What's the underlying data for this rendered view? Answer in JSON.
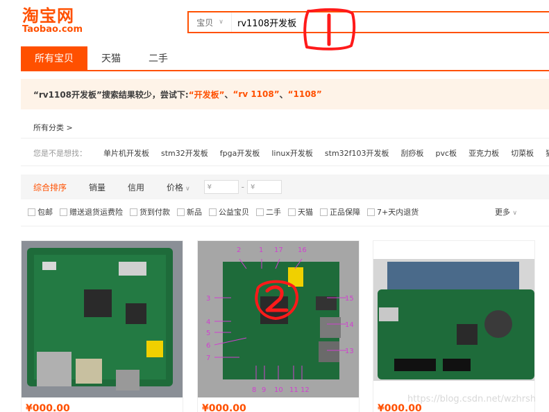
{
  "logo": {
    "cn": "淘宝网",
    "en": "Taobao.com"
  },
  "search": {
    "scope": "宝贝",
    "query": "rv1108开发板"
  },
  "tabs": [
    {
      "label": "所有宝贝"
    },
    {
      "label": "天猫"
    },
    {
      "label": "二手"
    }
  ],
  "tip": {
    "part1": "“rv1108开发板”搜索结果较少，尝试下:",
    "s1": "“开发板”",
    "sep1": "、",
    "s2": "“rv 1108”",
    "sep2": "、",
    "s3": "“1108”"
  },
  "breadcrumb": "所有分类 >",
  "suggest": {
    "label": "您是不是想找：",
    "items": [
      "单片机开发板",
      "stm32开发板",
      "fpga开发板",
      "linux开发板",
      "stm32f103开发板",
      "刮痧板",
      "pvc板",
      "亚克力板",
      "切菜板",
      "猫"
    ]
  },
  "sort": {
    "items": [
      "综合排序",
      "销量",
      "信用",
      "价格"
    ],
    "price_from": "¥",
    "price_to": "¥",
    "dash": "-"
  },
  "filters": {
    "items": [
      "包邮",
      "赠送退货运费险",
      "货到付款",
      "新品",
      "公益宝贝",
      "二手",
      "天猫",
      "正品保障",
      "7+天内退货"
    ],
    "more": "更多"
  },
  "annotations": {
    "a1": "1",
    "a2": "2"
  },
  "board_labels": [
    "2",
    "1",
    "17",
    "16",
    "3",
    "15",
    "4",
    "5",
    "14",
    "6",
    "13",
    "7",
    "8",
    "9",
    "10",
    "11",
    "12"
  ],
  "products": [
    {
      "price": "¥000.00"
    },
    {
      "price": "¥000.00"
    },
    {
      "price": "¥000.00"
    }
  ],
  "watermark": "https://blog.csdn.net/wzhrsh"
}
